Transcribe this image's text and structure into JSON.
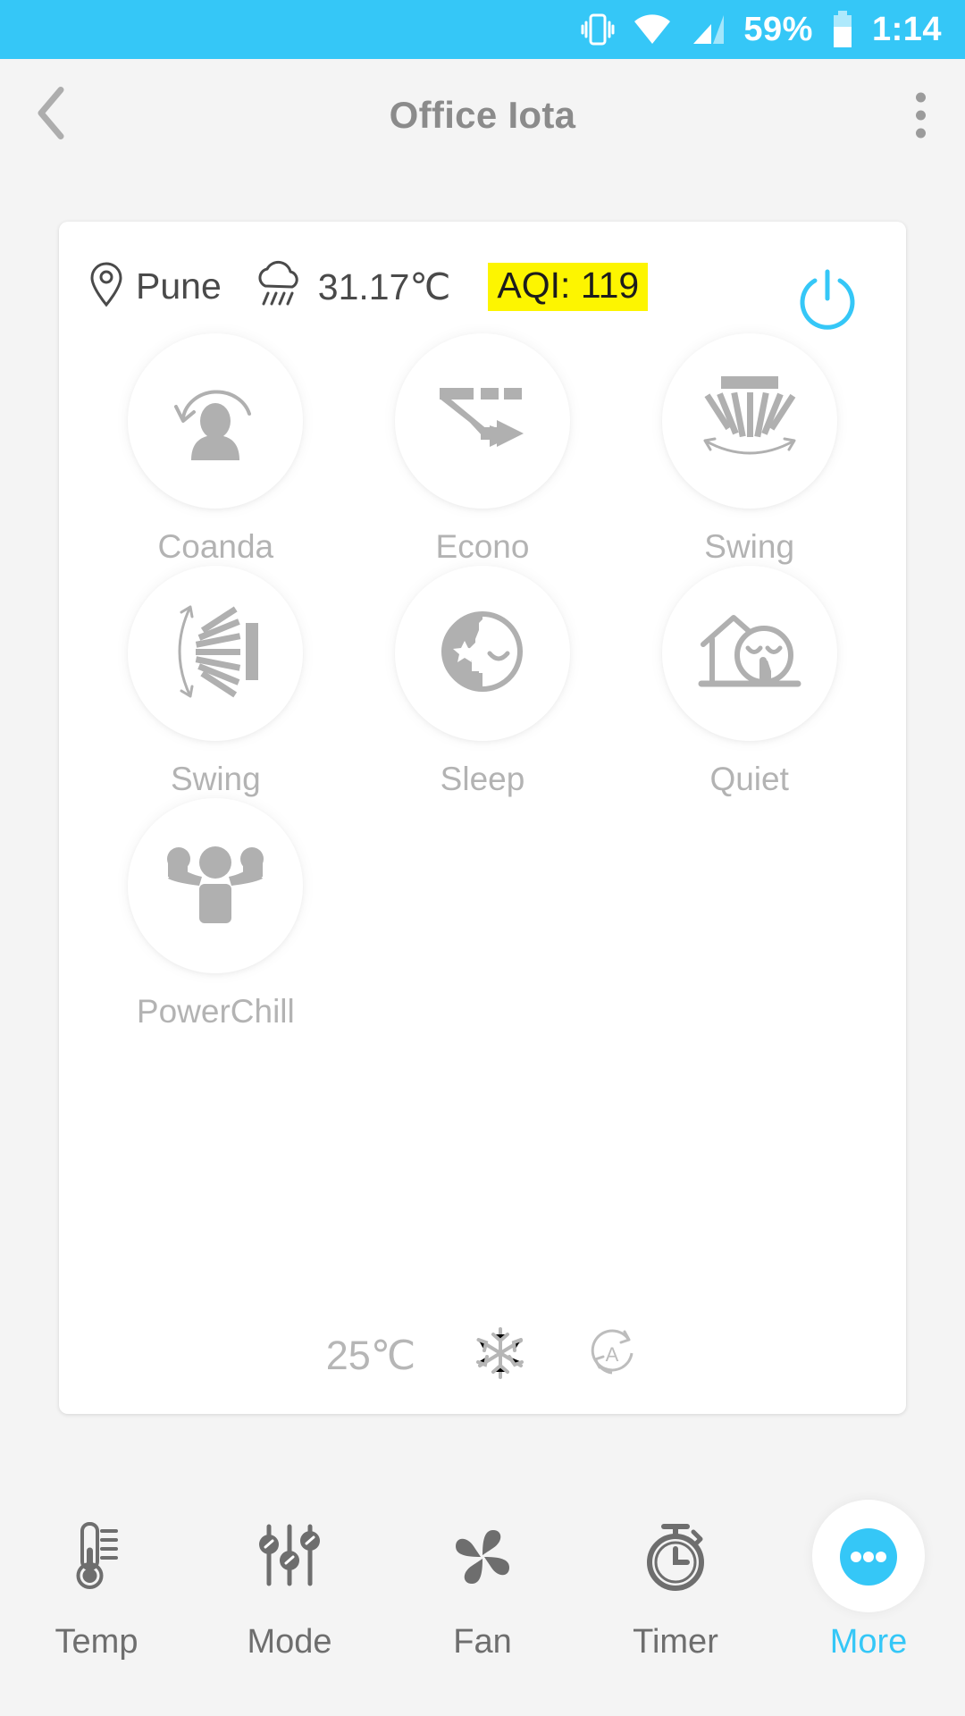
{
  "statusbar": {
    "vibrate_icon": "vibrate-icon",
    "wifi_icon": "wifi-icon",
    "signal_icon": "cellular-signal-icon",
    "battery_percent": "59%",
    "battery_icon": "battery-icon",
    "time": "1:14",
    "background_color": "#35c7f7"
  },
  "appbar": {
    "back_icon": "back-chevron-icon",
    "title": "Office Iota",
    "overflow_icon": "overflow-menu-icon"
  },
  "card": {
    "location_icon": "location-pin-icon",
    "location": "Pune",
    "weather_icon": "rain-cloud-icon",
    "outdoor_temp": "31.17℃",
    "aqi": "AQI: 119",
    "aqi_highlight_color": "#fdf500",
    "power_icon": "power-icon",
    "power_color": "#35c7f7",
    "features": [
      {
        "label": "Coanda",
        "icon": "coanda-airflow-icon"
      },
      {
        "label": "Econo",
        "icon": "econo-arrow-icon"
      },
      {
        "label": "Swing",
        "icon": "horizontal-swing-icon"
      },
      {
        "label": "Swing",
        "icon": "vertical-swing-icon"
      },
      {
        "label": "Sleep",
        "icon": "sleep-moon-face-icon"
      },
      {
        "label": "Quiet",
        "icon": "quiet-house-shush-icon"
      },
      {
        "label": "PowerChill",
        "icon": "powerchill-flex-icon"
      }
    ],
    "footer": {
      "set_temp": "25℃",
      "mode_icon": "snowflake-cool-icon",
      "fan_icon": "auto-fan-icon"
    }
  },
  "bottomnav": {
    "items": [
      {
        "label": "Temp",
        "icon": "thermometer-icon",
        "active": false
      },
      {
        "label": "Mode",
        "icon": "sliders-icon",
        "active": false
      },
      {
        "label": "Fan",
        "icon": "fan-blades-icon",
        "active": false
      },
      {
        "label": "Timer",
        "icon": "stopwatch-icon",
        "active": false
      },
      {
        "label": "More",
        "icon": "more-dots-icon",
        "active": true
      }
    ],
    "active_color": "#35c7f7",
    "inactive_color": "#6e6e6e"
  }
}
